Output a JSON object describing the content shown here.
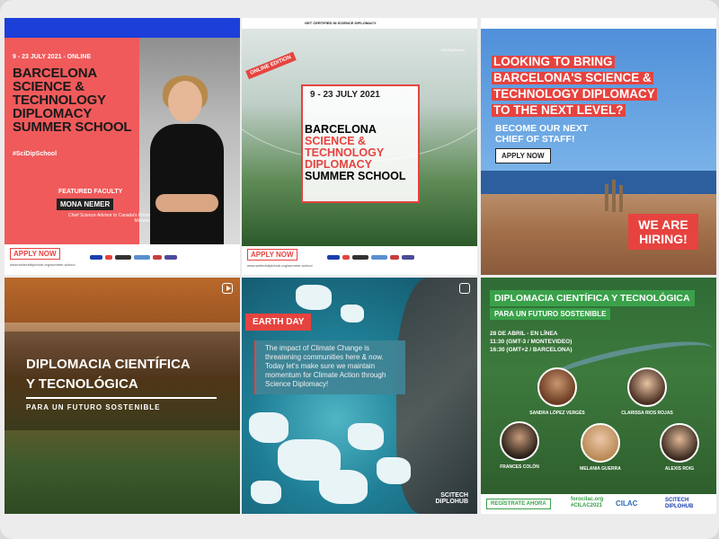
{
  "tile1": {
    "date": "9 - 23 JULY 2021 - ONLINE",
    "title": "BARCELONA SCIENCE & TECHNOLOGY DIPLOMACY SUMMER SCHOOL",
    "hashtag": "#SciDipSchool",
    "featured": "FEATURED FACULTY",
    "faculty_name": "MONA NEMER",
    "faculty_role": "Chief Science Advisor to Canada's Prime Minister",
    "apply": "APPLY NOW",
    "url": "www.scitechdiplohub.org/summer-school"
  },
  "tile2": {
    "banner_text": "GET CERTIFIED IN SCIENCE DIPLOMACY",
    "online_tag": "ONLINE EDITION",
    "date": "9 - 23 JULY 2021",
    "title_1": "BARCELONA",
    "title_2": "SCIENCE &",
    "title_3": "TECHNOLOGY",
    "title_4": "DIPLOMACY",
    "title_5": "SUMMER SCHOOL",
    "hashtag": "#SciDipSchool",
    "apply": "APPLY NOW",
    "url": "www.scitechdiplohub.org/summer-school"
  },
  "tile3": {
    "headline_1": "LOOKING TO BRING",
    "headline_2": "BARCELONA'S SCIENCE &",
    "headline_3": "TECHNOLOGY DIPLOMACY",
    "headline_4": "TO THE NEXT LEVEL?",
    "sub_1": "BECOME OUR NEXT",
    "sub_2": "CHIEF OF STAFF!",
    "apply": "APPLY NOW",
    "hiring": "WE ARE HIRING!"
  },
  "tile4": {
    "title_1": "DIPLOMACIA CIENTÍFICA",
    "title_2": "Y TECNOLÓGICA",
    "sub": "PARA UN FUTURO SOSTENIBLE"
  },
  "tile5": {
    "tag": "EARTH DAY",
    "message": "The impact of Climate Change is threatening communities here & now. Today let's make sure we maintain momentum for Climate Action through Science Diplomacy!",
    "brand_1": "SCITECH",
    "brand_2": "DIPLOHUB"
  },
  "tile6": {
    "title": "DIPLOMACIA CIENTÍFICA Y TECNOLÓGICA",
    "sub": "PARA UN FUTURO SOSTENIBLE",
    "event_1": "28 DE ABRIL - EN LÍNEA",
    "event_2": "11:30 (GMT-3 / MONTEVIDEO)",
    "event_3": "16:30 (GMT+2 / BARCELONA)",
    "speakers": [
      "SANDRA LÓPEZ VERGÉS",
      "CLARISSA RIOS ROJAS",
      "FRANCES COLÓN",
      "MELANIA GUERRA",
      "ALEXIS ROIG"
    ],
    "register": "REGÍSTRATE AHORA",
    "site_1": "foroc​ilac.org",
    "site_2": "#CILAC2021",
    "cilac": "CILAC",
    "brand_1": "SCITECH",
    "brand_2": "DIPLOHUB"
  }
}
